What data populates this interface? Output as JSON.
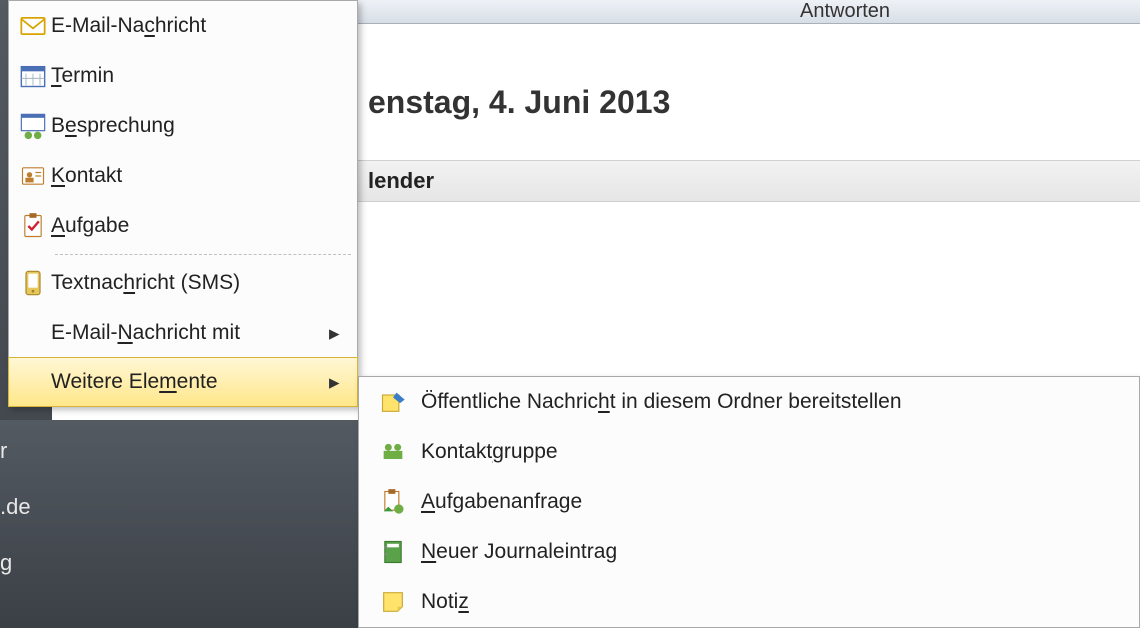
{
  "ribbon": {
    "group_label": "Antworten"
  },
  "main": {
    "date_heading_partial": "enstag, 4. Juni 2013",
    "calendar_label_partial": "lender"
  },
  "sidebar_fragments": {
    "a": "r",
    "b": ".de",
    "c": "g"
  },
  "menu": {
    "items": [
      {
        "label": "E-Mail-Nachricht",
        "icon": "mail-icon"
      },
      {
        "label": "Termin",
        "icon": "calendar-icon"
      },
      {
        "label": "Besprechung",
        "icon": "meeting-icon"
      },
      {
        "label": "Kontakt",
        "icon": "contact-icon"
      },
      {
        "label": "Aufgabe",
        "icon": "task-icon"
      }
    ],
    "items2": [
      {
        "label": "Textnachricht (SMS)",
        "icon": "sms-icon"
      },
      {
        "label": "E-Mail-Nachricht mit",
        "icon": "",
        "has_sub": true
      },
      {
        "label": "Weitere Elemente",
        "icon": "",
        "has_sub": true,
        "highlight": true
      }
    ]
  },
  "submenu": {
    "items": [
      {
        "label": "Öffentliche Nachricht in diesem Ordner bereitstellen",
        "icon": "post-icon"
      },
      {
        "label": "Kontaktgruppe",
        "icon": "contact-group-icon"
      },
      {
        "label": "Aufgabenanfrage",
        "icon": "task-request-icon"
      },
      {
        "label": "Neuer Journaleintrag",
        "icon": "journal-icon"
      },
      {
        "label": "Notiz",
        "icon": "note-icon"
      }
    ]
  }
}
